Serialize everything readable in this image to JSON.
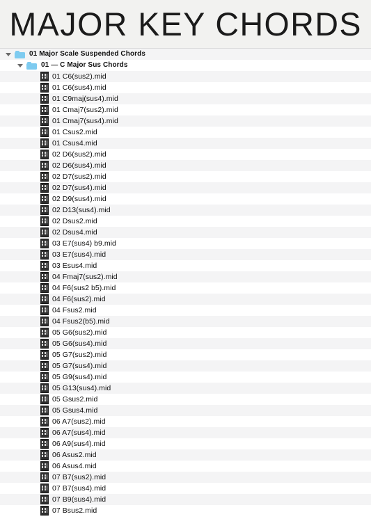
{
  "header": {
    "title": "MAJOR KEY CHORDS",
    "background_color": "#f2f2f0",
    "text_color": "#1b1b1b"
  },
  "colors": {
    "folder_icon": "#7ecbf0",
    "midi_icon": "#2e2e2e",
    "row_stripe": "#f4f4f5",
    "row_base": "#ffffff",
    "twisty": "#6a6a6a"
  },
  "file_browser": {
    "rows": [
      {
        "level": 0,
        "kind": "folder",
        "expanded": true,
        "icon": "folder-icon",
        "label": "01 Major Scale Suspended Chords"
      },
      {
        "level": 1,
        "kind": "folder",
        "expanded": true,
        "icon": "folder-icon",
        "label": "01 — C Major Sus Chords"
      },
      {
        "level": 2,
        "kind": "file",
        "expanded": false,
        "icon": "midi-file-icon",
        "label": "01 C6(sus2).mid"
      },
      {
        "level": 2,
        "kind": "file",
        "expanded": false,
        "icon": "midi-file-icon",
        "label": "01 C6(sus4).mid"
      },
      {
        "level": 2,
        "kind": "file",
        "expanded": false,
        "icon": "midi-file-icon",
        "label": "01 C9maj(sus4).mid"
      },
      {
        "level": 2,
        "kind": "file",
        "expanded": false,
        "icon": "midi-file-icon",
        "label": "01 Cmaj7(sus2).mid"
      },
      {
        "level": 2,
        "kind": "file",
        "expanded": false,
        "icon": "midi-file-icon",
        "label": "01 Cmaj7(sus4).mid"
      },
      {
        "level": 2,
        "kind": "file",
        "expanded": false,
        "icon": "midi-file-icon",
        "label": "01 Csus2.mid"
      },
      {
        "level": 2,
        "kind": "file",
        "expanded": false,
        "icon": "midi-file-icon",
        "label": "01 Csus4.mid"
      },
      {
        "level": 2,
        "kind": "file",
        "expanded": false,
        "icon": "midi-file-icon",
        "label": "02 D6(sus2).mid"
      },
      {
        "level": 2,
        "kind": "file",
        "expanded": false,
        "icon": "midi-file-icon",
        "label": "02 D6(sus4).mid"
      },
      {
        "level": 2,
        "kind": "file",
        "expanded": false,
        "icon": "midi-file-icon",
        "label": "02 D7(sus2).mid"
      },
      {
        "level": 2,
        "kind": "file",
        "expanded": false,
        "icon": "midi-file-icon",
        "label": "02 D7(sus4).mid"
      },
      {
        "level": 2,
        "kind": "file",
        "expanded": false,
        "icon": "midi-file-icon",
        "label": "02 D9(sus4).mid"
      },
      {
        "level": 2,
        "kind": "file",
        "expanded": false,
        "icon": "midi-file-icon",
        "label": "02 D13(sus4).mid"
      },
      {
        "level": 2,
        "kind": "file",
        "expanded": false,
        "icon": "midi-file-icon",
        "label": "02 Dsus2.mid"
      },
      {
        "level": 2,
        "kind": "file",
        "expanded": false,
        "icon": "midi-file-icon",
        "label": "02 Dsus4.mid"
      },
      {
        "level": 2,
        "kind": "file",
        "expanded": false,
        "icon": "midi-file-icon",
        "label": "03 E7(sus4) b9.mid"
      },
      {
        "level": 2,
        "kind": "file",
        "expanded": false,
        "icon": "midi-file-icon",
        "label": "03 E7(sus4).mid"
      },
      {
        "level": 2,
        "kind": "file",
        "expanded": false,
        "icon": "midi-file-icon",
        "label": "03 Esus4.mid"
      },
      {
        "level": 2,
        "kind": "file",
        "expanded": false,
        "icon": "midi-file-icon",
        "label": "04  Fmaj7(sus2).mid"
      },
      {
        "level": 2,
        "kind": "file",
        "expanded": false,
        "icon": "midi-file-icon",
        "label": "04 F6(sus2 b5).mid"
      },
      {
        "level": 2,
        "kind": "file",
        "expanded": false,
        "icon": "midi-file-icon",
        "label": "04 F6(sus2).mid"
      },
      {
        "level": 2,
        "kind": "file",
        "expanded": false,
        "icon": "midi-file-icon",
        "label": "04 Fsus2.mid"
      },
      {
        "level": 2,
        "kind": "file",
        "expanded": false,
        "icon": "midi-file-icon",
        "label": "04 Fsus2(b5).mid"
      },
      {
        "level": 2,
        "kind": "file",
        "expanded": false,
        "icon": "midi-file-icon",
        "label": "05 G6(sus2).mid"
      },
      {
        "level": 2,
        "kind": "file",
        "expanded": false,
        "icon": "midi-file-icon",
        "label": "05 G6(sus4).mid"
      },
      {
        "level": 2,
        "kind": "file",
        "expanded": false,
        "icon": "midi-file-icon",
        "label": "05 G7(sus2).mid"
      },
      {
        "level": 2,
        "kind": "file",
        "expanded": false,
        "icon": "midi-file-icon",
        "label": "05 G7(sus4).mid"
      },
      {
        "level": 2,
        "kind": "file",
        "expanded": false,
        "icon": "midi-file-icon",
        "label": "05 G9(sus4).mid"
      },
      {
        "level": 2,
        "kind": "file",
        "expanded": false,
        "icon": "midi-file-icon",
        "label": "05 G13(sus4).mid"
      },
      {
        "level": 2,
        "kind": "file",
        "expanded": false,
        "icon": "midi-file-icon",
        "label": "05 Gsus2.mid"
      },
      {
        "level": 2,
        "kind": "file",
        "expanded": false,
        "icon": "midi-file-icon",
        "label": "05 Gsus4.mid"
      },
      {
        "level": 2,
        "kind": "file",
        "expanded": false,
        "icon": "midi-file-icon",
        "label": "06 A7(sus2).mid"
      },
      {
        "level": 2,
        "kind": "file",
        "expanded": false,
        "icon": "midi-file-icon",
        "label": "06 A7(sus4).mid"
      },
      {
        "level": 2,
        "kind": "file",
        "expanded": false,
        "icon": "midi-file-icon",
        "label": "06 A9(sus4).mid"
      },
      {
        "level": 2,
        "kind": "file",
        "expanded": false,
        "icon": "midi-file-icon",
        "label": "06 Asus2.mid"
      },
      {
        "level": 2,
        "kind": "file",
        "expanded": false,
        "icon": "midi-file-icon",
        "label": "06 Asus4.mid"
      },
      {
        "level": 2,
        "kind": "file",
        "expanded": false,
        "icon": "midi-file-icon",
        "label": "07 B7(sus2).mid"
      },
      {
        "level": 2,
        "kind": "file",
        "expanded": false,
        "icon": "midi-file-icon",
        "label": "07 B7(sus4).mid"
      },
      {
        "level": 2,
        "kind": "file",
        "expanded": false,
        "icon": "midi-file-icon",
        "label": "07 B9(sus4).mid"
      },
      {
        "level": 2,
        "kind": "file",
        "expanded": false,
        "icon": "midi-file-icon",
        "label": "07 Bsus2.mid"
      }
    ]
  }
}
